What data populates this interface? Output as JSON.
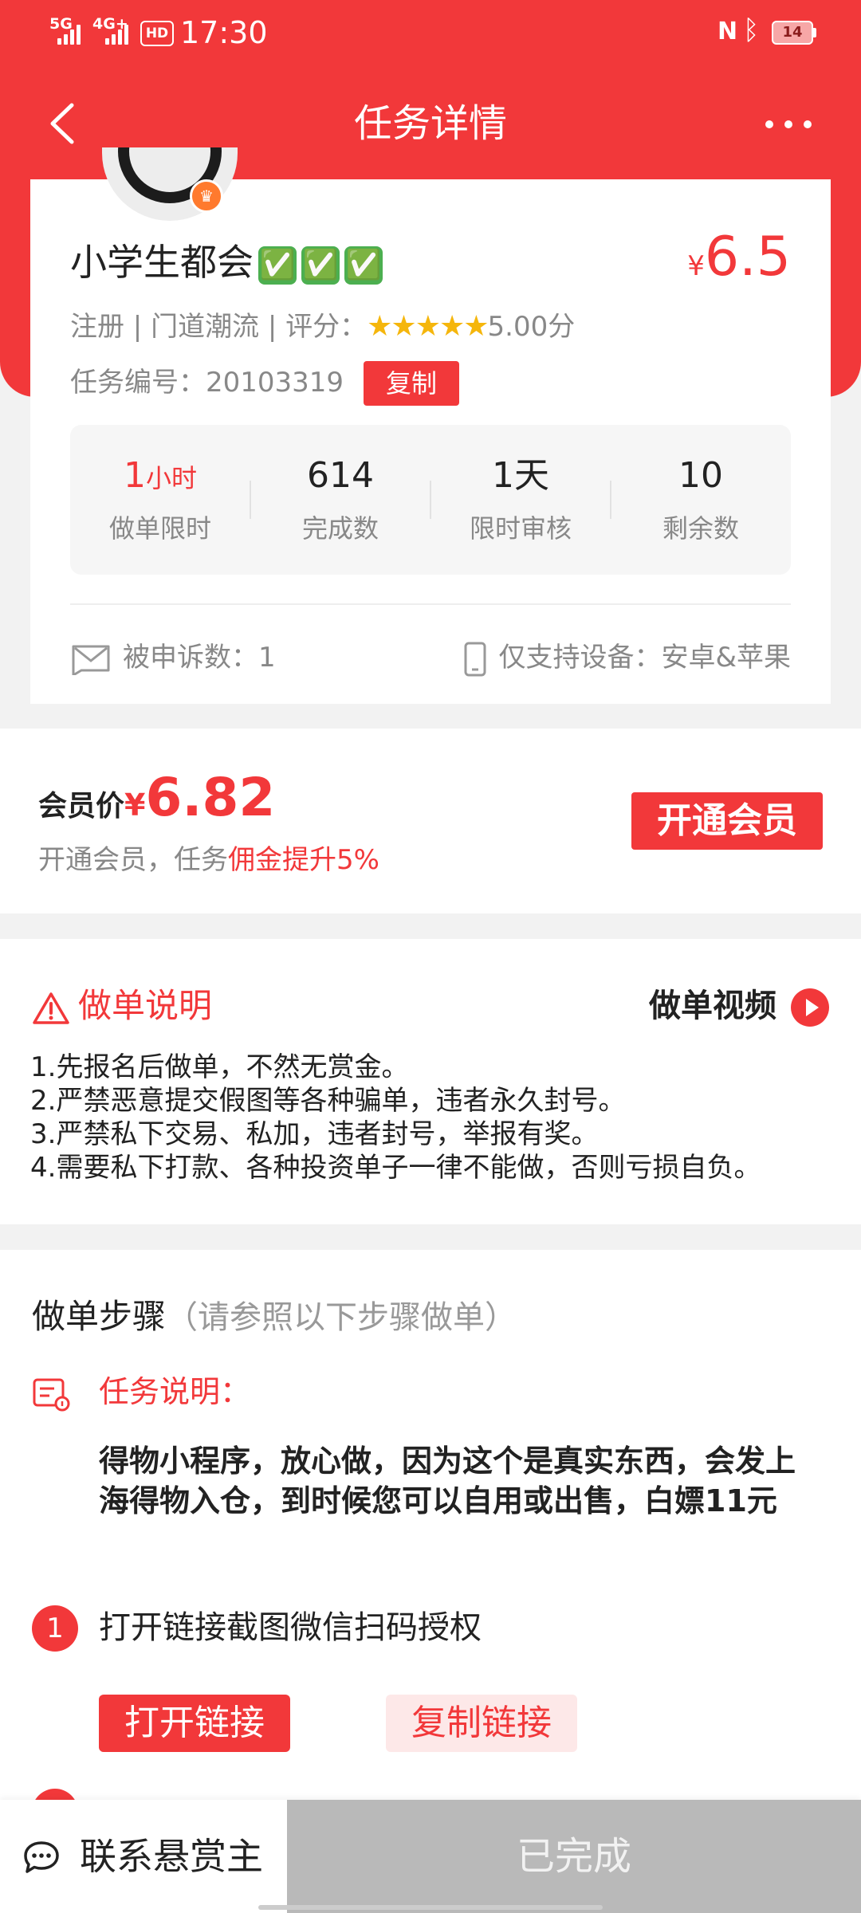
{
  "status_bar": {
    "net1": "5G",
    "net2": "4G+",
    "hd": "HD",
    "time": "17:30",
    "battery": "14"
  },
  "header": {
    "title": "任务详情",
    "back_icon": "chevron-left-icon",
    "more_icon": "more-dots-icon"
  },
  "task": {
    "title": "小学生都会",
    "title_emoji": [
      "✅",
      "✅",
      "✅"
    ],
    "price_currency": "¥",
    "price": "6.5",
    "meta_prefix": "注册 | 门道潮流 | 评分：",
    "stars": "★★★★★",
    "rating": "5.00分",
    "number_label": "任务编号：",
    "number": "20103319",
    "copy_label": "复制",
    "stats": [
      {
        "value": "1",
        "unit": "小时",
        "label": "做单限时"
      },
      {
        "value": "614",
        "unit": "",
        "label": "完成数"
      },
      {
        "value": "1天",
        "unit": "",
        "label": "限时审核"
      },
      {
        "value": "10",
        "unit": "",
        "label": "剩余数"
      }
    ],
    "complaint": "被申诉数：1",
    "device": "仅支持设备：安卓&苹果"
  },
  "member": {
    "label": "会员价",
    "currency": "¥",
    "price": "6.82",
    "tip_prefix": "开通会员，任务",
    "tip_highlight": "佣金提升5%",
    "button": "开通会员"
  },
  "instructions": {
    "title": "做单说明",
    "video_label": "做单视频",
    "items": [
      "1.先报名后做单，不然无赏金。",
      "2.严禁恶意提交假图等各种骗单，违者永久封号。",
      "3.严禁私下交易、私加，违者封号，举报有奖。",
      "4.需要私下打款、各种投资单子一律不能做，否则亏损自负。"
    ]
  },
  "steps": {
    "title": "做单步骤",
    "subtitle": "（请参照以下步骤做单）",
    "desc_label": "任务说明：",
    "desc": "得物小程序，放心做，因为这个是真实东西，会发上海得物入仓，到时候您可以自用或出售，白嫖11元",
    "step1_num": "1",
    "step1_text": "打开链接截图微信扫码授权",
    "open_link": "打开链接",
    "copy_link": "复制链接"
  },
  "bottom": {
    "contact": "联系悬赏主",
    "done": "已完成"
  },
  "colors": {
    "accent": "#f2383a",
    "done_bg": "#b9b9b9",
    "page_bg": "#f2f2f2"
  }
}
